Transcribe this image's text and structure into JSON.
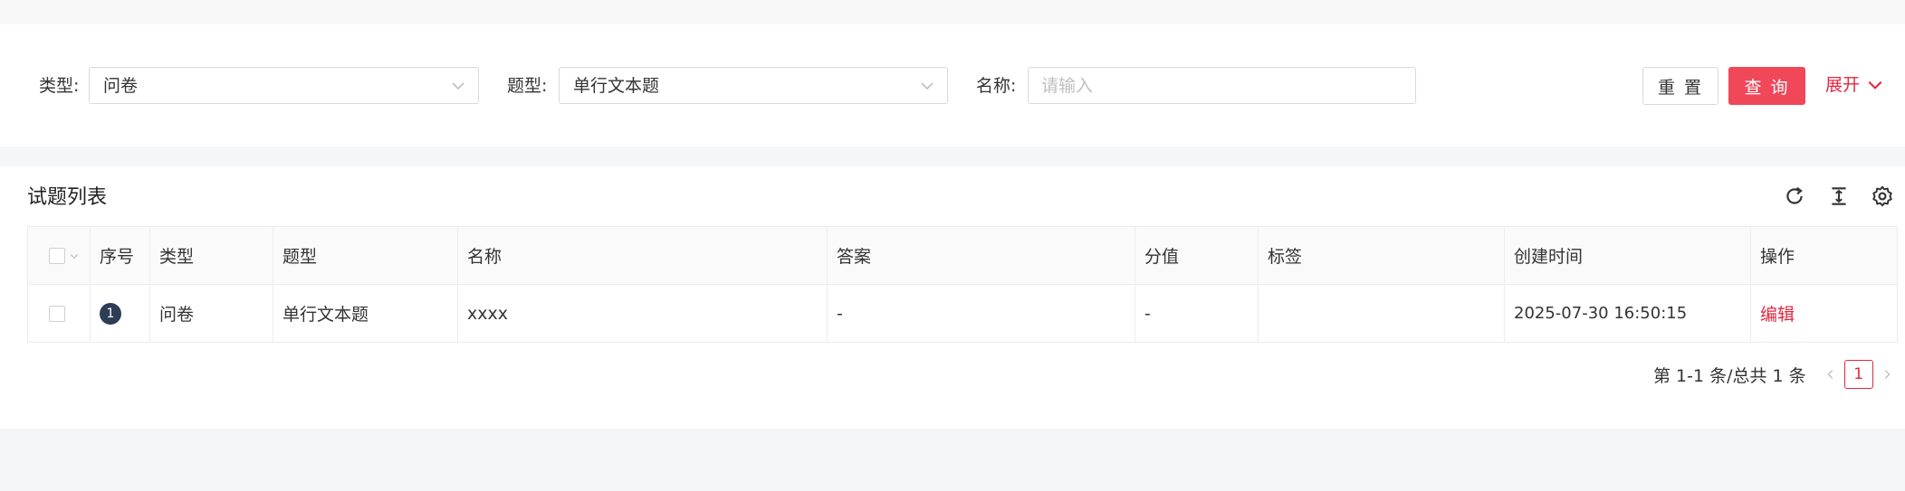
{
  "filters": {
    "type_label": "类型:",
    "type_value": "问卷",
    "question_type_label": "题型:",
    "question_type_value": "单行文本题",
    "name_label": "名称:",
    "name_value": "",
    "name_placeholder": "请输入"
  },
  "actions": {
    "reset_label": "重 置",
    "query_label": "查 询",
    "expand_label": "展开"
  },
  "list": {
    "title": "试题列表",
    "toolbar_icons": [
      "refresh-icon",
      "column-height-icon",
      "settings-icon"
    ],
    "columns": [
      "序号",
      "类型",
      "题型",
      "名称",
      "答案",
      "分值",
      "标签",
      "创建时间",
      "操作"
    ],
    "rows": [
      {
        "index": "1",
        "type": "问卷",
        "question_type": "单行文本题",
        "name": "xxxx",
        "answer": "-",
        "score": "-",
        "tags": "",
        "created_at": "2025-07-30 16:50:15",
        "action": "编辑"
      }
    ]
  },
  "pagination": {
    "summary": "第 1-1 条/总共 1 条",
    "current_page": "1"
  },
  "colors": {
    "accent": "#e0283f",
    "primary_button": "#f04759",
    "index_badge": "#2e3d54"
  }
}
